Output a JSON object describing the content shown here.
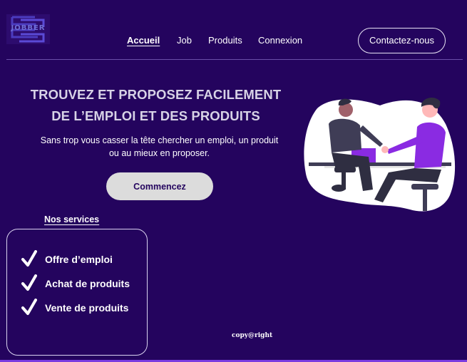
{
  "header": {
    "logo_text": "JOBBER",
    "nav": [
      {
        "label": "Accueil",
        "active": true
      },
      {
        "label": "Job",
        "active": false
      },
      {
        "label": "Produits",
        "active": false
      },
      {
        "label": "Connexion",
        "active": false
      }
    ],
    "contact_label": "Contactez-nous"
  },
  "hero": {
    "title_line1": "TROUVEZ ET PROPOSEZ FACILEMENT",
    "title_line2": "DE L’EMPLOI ET DES PRODUITS",
    "subtitle": "Sans trop vous casser la tête chercher un emploi, un produit ou au mieux en proposer.",
    "cta_label": "Commencez",
    "illustration_icon": "handshake-illustration"
  },
  "services": {
    "title": "Nos services",
    "items": [
      {
        "label": "Offre d’emploi",
        "icon": "check-icon"
      },
      {
        "label": "Achat de produits",
        "icon": "check-icon"
      },
      {
        "label": "Vente de produits",
        "icon": "check-icon"
      }
    ]
  },
  "footer": {
    "copyright": "copy@right"
  },
  "colors": {
    "background": "#24045e",
    "accent": "#8a2be2",
    "button": "#dcdcdc"
  }
}
